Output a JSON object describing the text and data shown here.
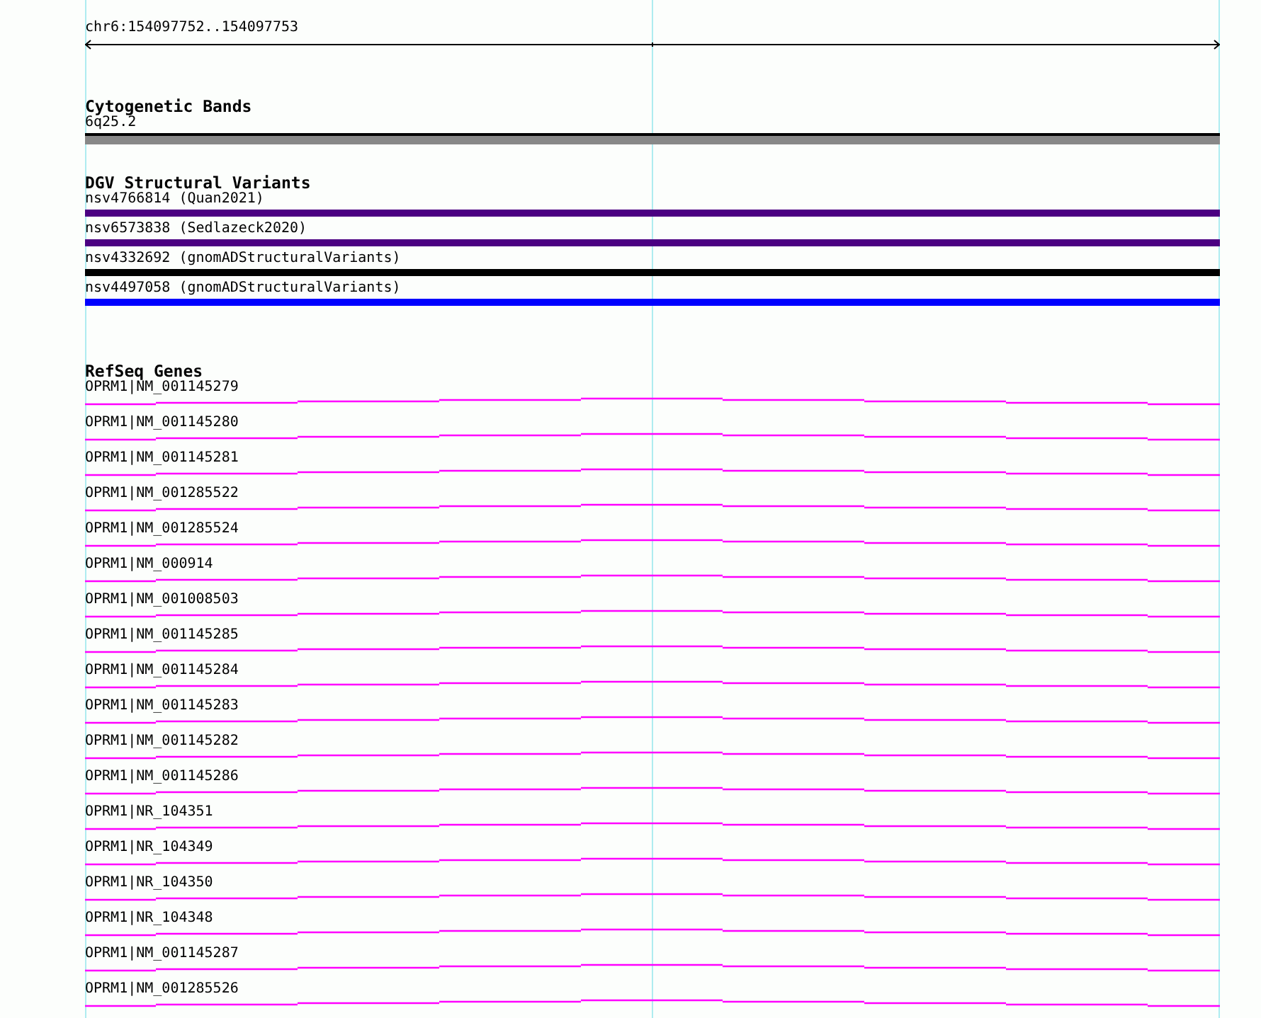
{
  "ruler": {
    "label": "chr6:154097752..154097753"
  },
  "tracks": [
    {
      "kind": "bands",
      "title": "Cytogenetic Bands",
      "items": [
        {
          "label": "6q25.2",
          "color": "#888888"
        }
      ]
    },
    {
      "kind": "variants",
      "title": "DGV Structural Variants",
      "items": [
        {
          "label": "nsv4766814 (Quan2021)",
          "color": "#4b0082"
        },
        {
          "label": "nsv6573838 (Sedlazeck2020)",
          "color": "#4b0082"
        },
        {
          "label": "nsv4332692 (gnomADStructuralVariants)",
          "color": "#000000"
        },
        {
          "label": "nsv4497058 (gnomADStructuralVariants)",
          "color": "#0000ff"
        }
      ]
    },
    {
      "kind": "genes",
      "title": "RefSeq Genes",
      "items": [
        {
          "label": "OPRM1|NM_001145279"
        },
        {
          "label": "OPRM1|NM_001145280"
        },
        {
          "label": "OPRM1|NM_001145281"
        },
        {
          "label": "OPRM1|NM_001285522"
        },
        {
          "label": "OPRM1|NM_001285524"
        },
        {
          "label": "OPRM1|NM_000914"
        },
        {
          "label": "OPRM1|NM_001008503"
        },
        {
          "label": "OPRM1|NM_001145285"
        },
        {
          "label": "OPRM1|NM_001145284"
        },
        {
          "label": "OPRM1|NM_001145283"
        },
        {
          "label": "OPRM1|NM_001145282"
        },
        {
          "label": "OPRM1|NM_001145286"
        },
        {
          "label": "OPRM1|NR_104351"
        },
        {
          "label": "OPRM1|NR_104349"
        },
        {
          "label": "OPRM1|NR_104350"
        },
        {
          "label": "OPRM1|NR_104348"
        },
        {
          "label": "OPRM1|NM_001145287"
        },
        {
          "label": "OPRM1|NM_001285526"
        }
      ]
    }
  ]
}
